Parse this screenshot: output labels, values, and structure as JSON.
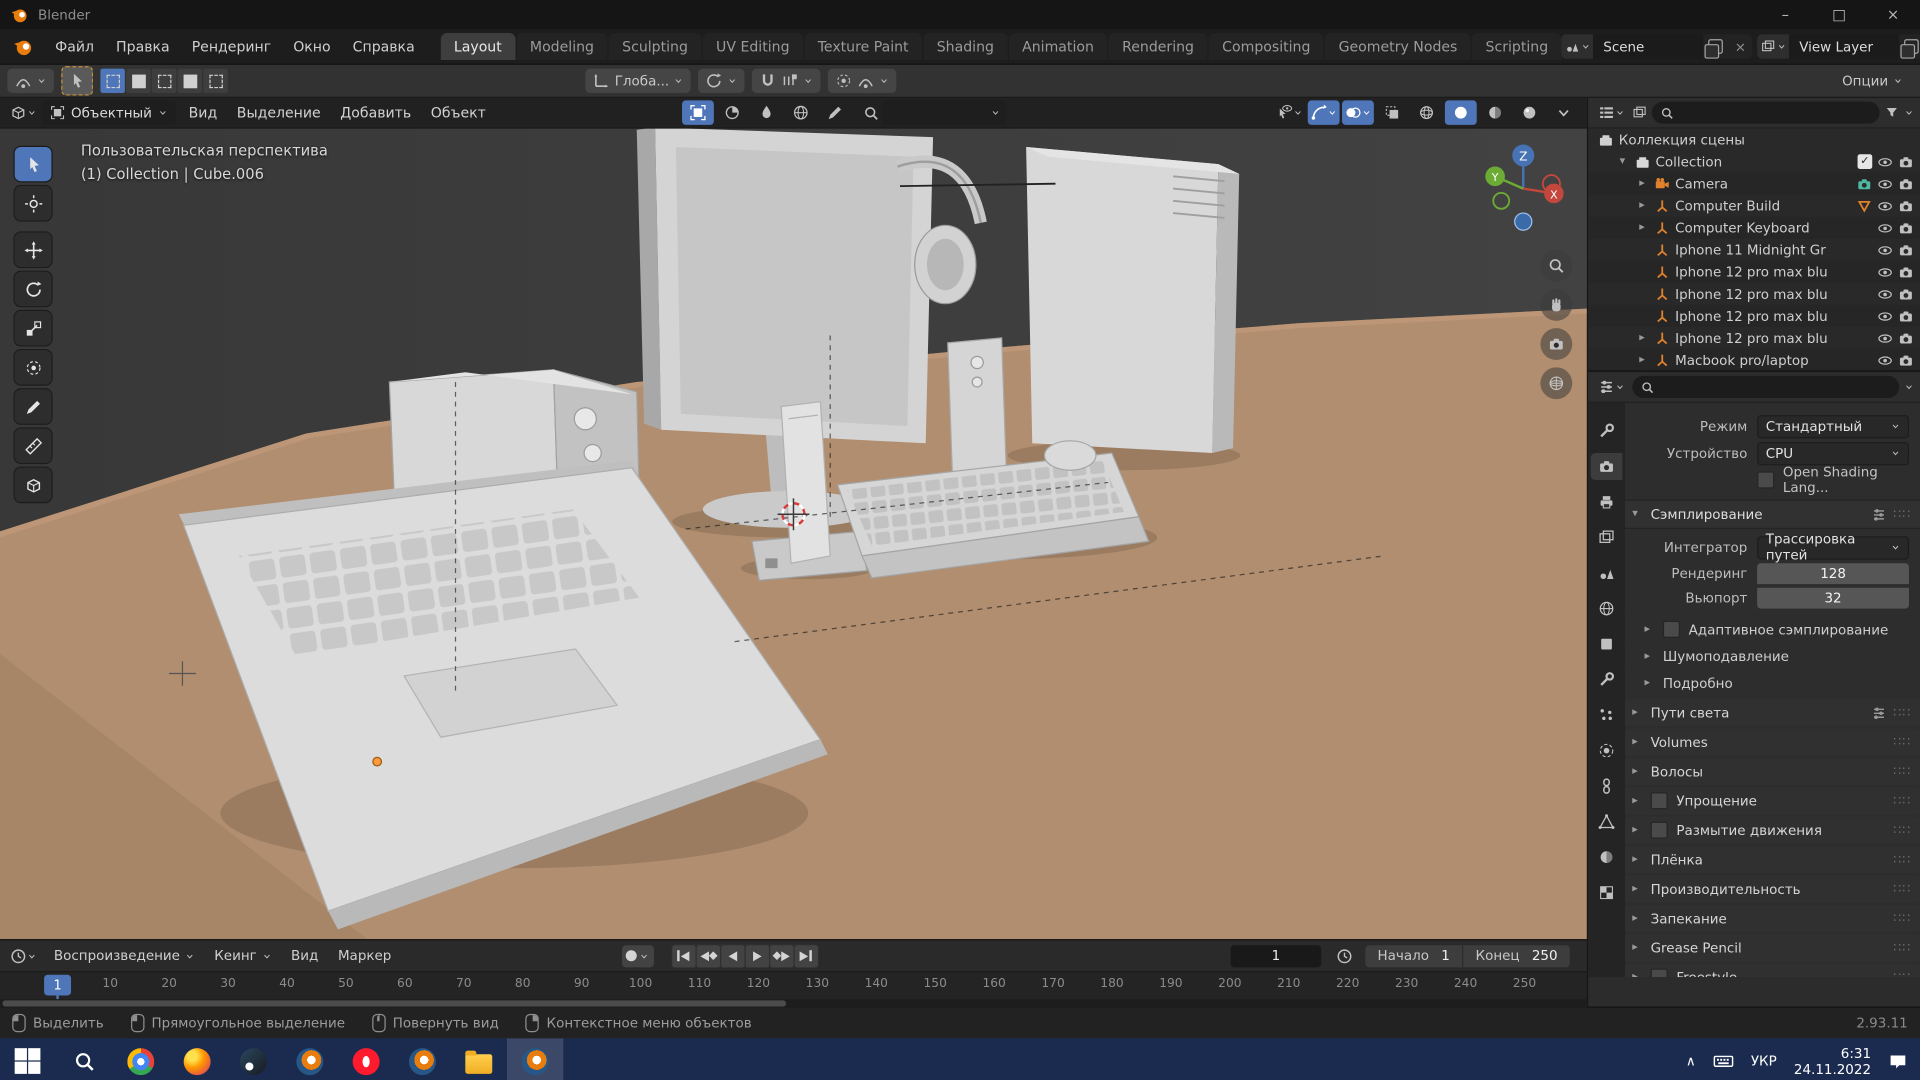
{
  "colors": {
    "accent": "#4f76b8",
    "orange": "#e0822c",
    "desk": "#b18e6f",
    "taskbar": "#1b2b4f"
  },
  "window": {
    "title": "Blender",
    "minimize": "–",
    "maximize": "□",
    "close": "×"
  },
  "topbar": {
    "menus": [
      {
        "label": "Файл"
      },
      {
        "label": "Правка"
      },
      {
        "label": "Рендеринг"
      },
      {
        "label": "Окно"
      },
      {
        "label": "Справка"
      }
    ],
    "tabs": [
      {
        "label": "Layout",
        "active": true
      },
      {
        "label": "Modeling"
      },
      {
        "label": "Sculpting"
      },
      {
        "label": "UV Editing"
      },
      {
        "label": "Texture Paint"
      },
      {
        "label": "Shading"
      },
      {
        "label": "Animation"
      },
      {
        "label": "Rendering"
      },
      {
        "label": "Compositing"
      },
      {
        "label": "Geometry Nodes"
      },
      {
        "label": "Scripting"
      }
    ],
    "scene_name": "Scene",
    "view_layer_name": "View Layer"
  },
  "tool_settings": {
    "orientation": "Глоба...",
    "options_label": "Опции"
  },
  "viewport": {
    "mode": "Объектный",
    "menus": [
      {
        "label": "Вид"
      },
      {
        "label": "Выделение"
      },
      {
        "label": "Добавить"
      },
      {
        "label": "Объект"
      }
    ],
    "overlay_line1": "Пользовательская перспектива",
    "overlay_line2": "(1) Collection | Cube.006",
    "axis_z": "Z",
    "axis_y": "Y",
    "axis_x": "X",
    "tools": [
      {
        "name": "select-box-tool",
        "icon": "cursor",
        "active": true
      },
      {
        "name": "cursor-tool",
        "icon": "cross"
      },
      {
        "name": "move-tool",
        "icon": "move"
      },
      {
        "name": "rotate-tool",
        "icon": "rotate"
      },
      {
        "name": "scale-tool",
        "icon": "scale"
      },
      {
        "name": "transform-tool",
        "icon": "xformall"
      },
      {
        "name": "annotate-tool",
        "icon": "pen"
      },
      {
        "name": "measure-tool",
        "icon": "measure"
      },
      {
        "name": "add-cube-tool",
        "icon": "cube"
      }
    ],
    "center_icons": [
      {
        "name": "bracket-select-icon",
        "icon": "objmode",
        "active": true
      },
      {
        "name": "shading-pie-icon",
        "icon": "pie"
      },
      {
        "name": "matcap-drop-icon",
        "icon": "drop"
      },
      {
        "name": "world-globe-icon",
        "icon": "world"
      },
      {
        "name": "brush-icon",
        "icon": "pen"
      }
    ],
    "right_icons": [
      {
        "name": "visibility-icon",
        "icon": "viscursor",
        "chev": true
      },
      {
        "name": "gizmos-icon",
        "icon": "gizmoarc",
        "chev": true,
        "active": true
      },
      {
        "name": "overlays-icon",
        "icon": "overlay",
        "chev": true,
        "active": true
      },
      {
        "name": "xray-toggle-icon",
        "icon": "xray"
      },
      {
        "name": "shading-wireframe-icon",
        "icon": "wireball"
      },
      {
        "name": "shading-solid-icon",
        "icon": "solidball",
        "active": true
      },
      {
        "name": "shading-material-icon",
        "icon": "matsphere"
      },
      {
        "name": "shading-rendered-icon",
        "icon": "rendball"
      },
      {
        "name": "shading-dropdown-icon",
        "icon": "chev"
      }
    ]
  },
  "outliner": {
    "root_label": "Коллекция сцены",
    "rows": [
      {
        "label": "Collection",
        "level": 1,
        "arrow": "▾",
        "icon": "collection",
        "iconcolor": "#d8d8d8",
        "check": true
      },
      {
        "label": "Camera",
        "level": 2,
        "arrow": "▸",
        "icon": "moviecam",
        "badge_icon": "cam",
        "badge_color": "#4fb8a0"
      },
      {
        "label": "Computer Build",
        "level": 2,
        "arrow": "▸",
        "icon": "axisempty",
        "badge_icon": "tridown",
        "badge_color": "#e0822c"
      },
      {
        "label": "Computer Keyboard",
        "level": 2,
        "arrow": "▸",
        "icon": "axisempty"
      },
      {
        "label": "Iphone 11 Midnight Gr",
        "level": 2,
        "arrow": "",
        "icon": "axisempty"
      },
      {
        "label": "Iphone 12 pro max blu",
        "level": 2,
        "arrow": "",
        "icon": "axisempty"
      },
      {
        "label": "Iphone 12 pro max blu",
        "level": 2,
        "arrow": "",
        "icon": "axisempty"
      },
      {
        "label": "Iphone 12 pro max blu",
        "level": 2,
        "arrow": "",
        "icon": "axisempty"
      },
      {
        "label": "Iphone 12 pro max blu",
        "level": 2,
        "arrow": "▸",
        "icon": "axisempty"
      },
      {
        "label": "Macbook pro/laptop",
        "level": 2,
        "arrow": "▸",
        "icon": "axisempty"
      }
    ]
  },
  "properties": {
    "mode_label": "Режим",
    "mode_value": "Стандартный",
    "device_label": "Устройство",
    "device_value": "CPU",
    "osl_label": "Open Shading Lang...",
    "sampling_header": "Сэмплирование",
    "integrator_label": "Интегратор",
    "integrator_value": "Трассировка путей",
    "render_label": "Рендеринг",
    "render_value": "128",
    "viewport_label": "Вьюпорт",
    "viewport_value": "32",
    "subpanels": [
      {
        "label": "Адаптивное сэмплирование",
        "checkbox": true
      },
      {
        "label": "Шумоподавление"
      },
      {
        "label": "Подробно"
      }
    ],
    "panels": [
      {
        "label": "Пути света",
        "presets": true
      },
      {
        "label": "Volumes"
      },
      {
        "label": "Волосы"
      },
      {
        "label": "Упрощение",
        "checkbox": true
      },
      {
        "label": "Размытие движения",
        "checkbox": true
      },
      {
        "label": "Плёнка"
      },
      {
        "label": "Производительность"
      },
      {
        "label": "Запекание"
      },
      {
        "label": "Grease Pencil"
      },
      {
        "label": "Freestyle",
        "checkbox": true
      }
    ],
    "tabs": [
      {
        "name": "tab-tool",
        "icon": "wrench"
      },
      {
        "name": "tab-render",
        "icon": "cam",
        "active": true
      },
      {
        "name": "tab-output",
        "icon": "printer"
      },
      {
        "name": "tab-view-layer",
        "icon": "images"
      },
      {
        "name": "tab-scene",
        "icon": "scene"
      },
      {
        "name": "tab-world",
        "icon": "world"
      },
      {
        "name": "tab-object",
        "icon": "square",
        "color": "#e0822c"
      },
      {
        "name": "tab-modifiers",
        "icon": "wrench",
        "color": "#6f9fd8"
      },
      {
        "name": "tab-particles",
        "icon": "particles",
        "color": "#6f9fd8"
      },
      {
        "name": "tab-physics",
        "icon": "physics",
        "color": "#6f9fd8"
      },
      {
        "name": "tab-constraints",
        "icon": "constraint"
      },
      {
        "name": "tab-object-data",
        "icon": "mesh",
        "color": "#8fce44"
      },
      {
        "name": "tab-material",
        "icon": "matsphere",
        "color": "#d36a6a"
      },
      {
        "name": "tab-texture",
        "icon": "checker",
        "color": "#d390b8"
      }
    ]
  },
  "timeline": {
    "menus": [
      {
        "label": "Воспроизведение",
        "chev": true
      },
      {
        "label": "Кеинг",
        "chev": true
      },
      {
        "label": "Вид"
      },
      {
        "label": "Маркер"
      }
    ],
    "buttons": [
      "jump-to-start",
      "prev-keyframe",
      "play-reverse",
      "play",
      "next-keyframe",
      "jump-to-end"
    ],
    "current_frame": "1",
    "start_label": "Начало",
    "start_value": "1",
    "end_label": "Конец",
    "end_value": "250",
    "ticks": [
      "10",
      "20",
      "30",
      "40",
      "50",
      "60",
      "70",
      "80",
      "90",
      "100",
      "110",
      "120",
      "130",
      "140",
      "150",
      "160",
      "170",
      "180",
      "190",
      "200",
      "210",
      "220",
      "230",
      "240",
      "250"
    ]
  },
  "statusbar": {
    "hints": [
      {
        "label": "Выделить",
        "icon": "mouse-left"
      },
      {
        "label": "Прямоугольное выделение",
        "icon": "mouse-left-drag"
      },
      {
        "label": "Повернуть вид",
        "icon": "mouse-middle"
      },
      {
        "label": "Контекстное меню объектов",
        "icon": "mouse-right"
      }
    ],
    "version": "2.93.11"
  },
  "taskbar": {
    "apps": [
      {
        "name": "start-button",
        "icon": "start"
      },
      {
        "name": "search-button",
        "icon": "search"
      },
      {
        "name": "chrome-icon",
        "icon": "chrome"
      },
      {
        "name": "firefox-icon",
        "icon": "firefox"
      },
      {
        "name": "steam-icon",
        "icon": "steam"
      },
      {
        "name": "blender-icon",
        "icon": "blender"
      },
      {
        "name": "opera-icon",
        "icon": "opera"
      },
      {
        "name": "blender-icon-2",
        "icon": "blender"
      },
      {
        "name": "explorer-icon",
        "icon": "folder"
      },
      {
        "name": "blender-active-icon",
        "icon": "blender",
        "active": true
      }
    ],
    "tray_chevron": "∧",
    "language": "УКР",
    "time": "6:31",
    "date": "24.11.2022"
  }
}
